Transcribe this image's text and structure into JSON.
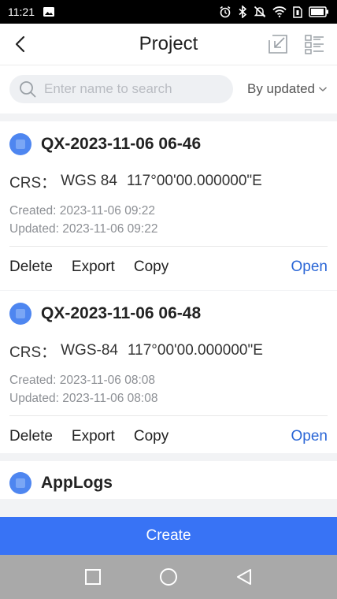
{
  "status_bar": {
    "time": "11:21",
    "icons": [
      "image-icon",
      "alarm-icon",
      "bluetooth-icon",
      "mute-icon",
      "wifi-icon",
      "sim-icon",
      "battery-icon"
    ]
  },
  "header": {
    "title": "Project",
    "back_icon": "chevron-left-icon",
    "import_icon": "import-icon",
    "list_icon": "list-icon"
  },
  "search": {
    "placeholder": "Enter name to search",
    "value": "",
    "sort_label": "By updated"
  },
  "projects": [
    {
      "name": "QX-2023-11-06 06-46",
      "crs_label": "CRS：",
      "crs_name": "WGS 84",
      "crs_meridian": "117°00'00.000000\"E",
      "created": "Created: 2023-11-06 09:22",
      "updated": "Updated: 2023-11-06 09:22",
      "actions": {
        "delete": "Delete",
        "export": "Export",
        "copy": "Copy",
        "open": "Open"
      }
    },
    {
      "name": "QX-2023-11-06 06-48",
      "crs_label": "CRS：",
      "crs_name": "WGS-84",
      "crs_meridian": "117°00'00.000000\"E",
      "created": "Created: 2023-11-06 08:08",
      "updated": "Updated: 2023-11-06 08:08",
      "actions": {
        "delete": "Delete",
        "export": "Export",
        "copy": "Copy",
        "open": "Open"
      }
    },
    {
      "name": "AppLogs"
    }
  ],
  "create_label": "Create",
  "nav": {
    "icons": [
      "recents-icon",
      "home-icon",
      "back-icon"
    ]
  },
  "colors": {
    "accent": "#3873f5",
    "link": "#2a66d6",
    "project_icon": "#4e86f0",
    "nav_bar": "#a9a9a9"
  }
}
